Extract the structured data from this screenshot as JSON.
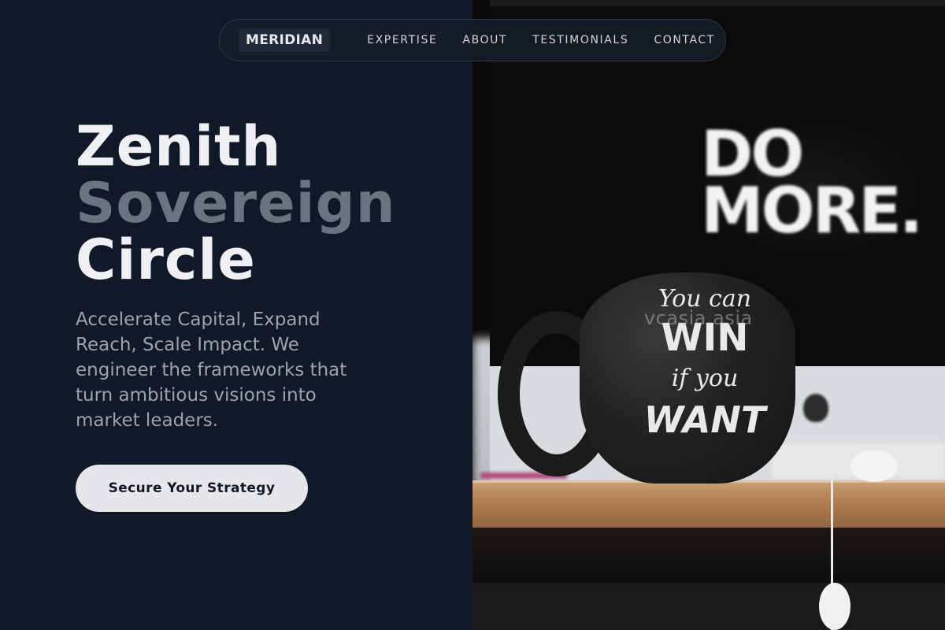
{
  "nav": {
    "logo": "MERIDIAN",
    "links": [
      {
        "label": "EXPERTISE"
      },
      {
        "label": "ABOUT"
      },
      {
        "label": "TESTIMONIALS"
      },
      {
        "label": "CONTACT"
      }
    ]
  },
  "hero": {
    "title_line1": "Zenith",
    "title_line2": "Sovereign",
    "title_line3": "Circle",
    "subtitle": "Accelerate Capital, Expand Reach, Scale Impact. We engineer the frameworks that turn ambitious visions into market leaders.",
    "cta_label": "Secure Your Strategy"
  },
  "image": {
    "screen_text_line1": "DO",
    "screen_text_line2": "MORE.",
    "mug_line1": "You can",
    "mug_line2": "WIN",
    "mug_line3": "if you",
    "mug_line4": "WANT",
    "watermark": "vcasia.asia"
  },
  "colors": {
    "background": "#111827",
    "title_primary": "#eef0f4",
    "title_muted": "#6b7280",
    "subtitle": "#9ca3af",
    "cta_bg": "#e5e7eb"
  }
}
